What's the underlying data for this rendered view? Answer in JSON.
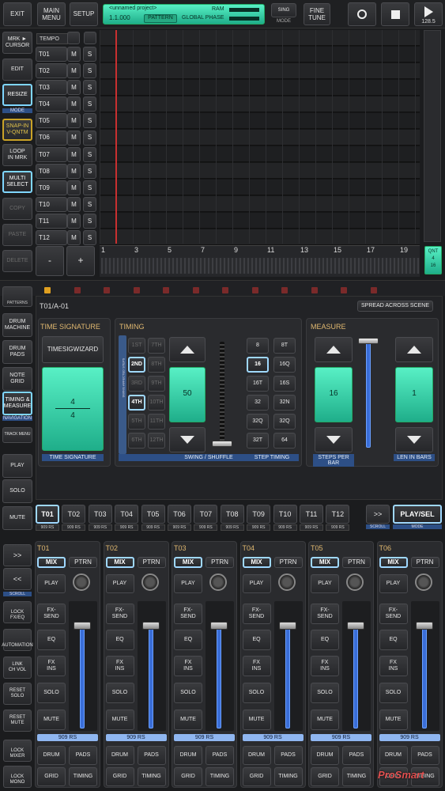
{
  "toolbar": {
    "exit": "EXIT",
    "main_menu": "MAIN MENU",
    "setup": "SETUP",
    "project_name": "<unnamed project>",
    "position": "1.1.000",
    "pattern_button": "PATTERN",
    "ram_label": "RAM",
    "global_phase_label": "GLOBAL PHASE",
    "sing_label": "SING",
    "mode_label": "MODE",
    "fine_tune": "FINE\nTUNE",
    "bpm": "128.5"
  },
  "left_tools": [
    {
      "label": "MRK ►\nCURSOR",
      "state": "normal"
    },
    {
      "label": "EDIT",
      "state": "normal"
    },
    {
      "label": "RESIZE",
      "state": "hl"
    },
    {
      "label": "SNAP-IN\nV-QNTM",
      "state": "yel"
    },
    {
      "label": "LOOP\nIN MRK",
      "state": "normal"
    },
    {
      "label": "MULTI\nSELECT",
      "state": "hl"
    },
    {
      "label": "COPY",
      "state": "dim"
    },
    {
      "label": "PASTE",
      "state": "dim"
    },
    {
      "label": "DELETE",
      "state": "dim"
    }
  ],
  "mode_label": "MODE",
  "tracks_header": "TEMPO",
  "tracks": [
    "T01",
    "T02",
    "T03",
    "T04",
    "T05",
    "T06",
    "T07",
    "T08",
    "T09",
    "T10",
    "T11",
    "T12"
  ],
  "mute_label": "M",
  "solo_label": "S",
  "zoom_minus": "-",
  "zoom_plus": "+",
  "ruler": [
    "1",
    "3",
    "5",
    "7",
    "9",
    "11",
    "13",
    "15",
    "17",
    "19"
  ],
  "qnt": {
    "label": "QNT",
    "value1": "4",
    "value2": "16"
  },
  "nav_buttons": [
    {
      "label": "DRUM\nMACHINE"
    },
    {
      "label": "DRUM\nPADS"
    },
    {
      "label": "NOTE\nGRID"
    },
    {
      "label": "TIMING &\nMEASURE"
    },
    {
      "label": "TRACK MENU"
    },
    {
      "label": "PLAY"
    },
    {
      "label": "SOLO"
    },
    {
      "label": "MUTE"
    }
  ],
  "patterns_label": "PATTERNS",
  "navigation_label": "NAVIGATION",
  "editor": {
    "title": "T01/A-01",
    "spread_button": "SPREAD ACROSS SCENE",
    "time_signature": {
      "section": "TIME SIGNATURE",
      "wizard": "TIMESIGWIZARD",
      "numerator": "4",
      "denominator": "4",
      "caption": "TIME SIGNATURE"
    },
    "timing": {
      "section": "TIMING",
      "steps": [
        [
          "1ST",
          "7TH"
        ],
        [
          "2ND",
          "8TH"
        ],
        [
          "3RD",
          "9TH"
        ],
        [
          "4TH",
          "10TH"
        ],
        [
          "5TH",
          "11TH"
        ],
        [
          "6TH",
          "12TH"
        ]
      ],
      "side_label": "SWING AFFECTED STEPS",
      "swing_value": "50",
      "swing_caption": "SWING / SHUFFLE",
      "step_timing": [
        [
          "8",
          "8T"
        ],
        [
          "16",
          "16Q"
        ],
        [
          "16T",
          "16S"
        ],
        [
          "32",
          "32N"
        ],
        [
          "32Q",
          "32Q"
        ],
        [
          "32T",
          "64"
        ]
      ],
      "step_caption": "STEP TIMING"
    },
    "measure": {
      "section": "MEASURE",
      "steps_per_bar": "16",
      "steps_caption": "STEPS PER BAR",
      "len_in_bars": "1",
      "len_caption": "LEN IN BARS"
    }
  },
  "track_tabs": [
    "T01",
    "T02",
    "T03",
    "T04",
    "T05",
    "T06",
    "T07",
    "T08",
    "T09",
    "T10",
    "T11",
    "T12"
  ],
  "track_tab_sub": "909 RS",
  "more_tab": ">>",
  "scroll_label": "SCROLL",
  "play_sel": "PLAY/SEL",
  "mode_sub": "MODE",
  "mixer_left": [
    {
      "label": ">>"
    },
    {
      "label": "<<"
    },
    {
      "label": "LOCK FX/EQ"
    },
    {
      "label": "AUTOMATION"
    },
    {
      "label": "LINK\nCH VOL"
    },
    {
      "label": "RESET\nSOLO"
    },
    {
      "label": "RESET\nMUTE"
    },
    {
      "label": "LOCK MIXER"
    },
    {
      "label": "LOCK MONO"
    }
  ],
  "channels": [
    {
      "name": "T01",
      "instrument": "909 RS"
    },
    {
      "name": "T02",
      "instrument": "909 RS"
    },
    {
      "name": "T03",
      "instrument": "909 RS"
    },
    {
      "name": "T04",
      "instrument": "909 RS"
    },
    {
      "name": "T05",
      "instrument": "909 RS"
    },
    {
      "name": "T06",
      "instrument": "909 RS"
    }
  ],
  "channel_buttons": {
    "mix": "MIX",
    "ptrn": "PTRN",
    "play": "PLAY",
    "fx_send": "FX-\nSEND",
    "eq": "EQ",
    "fx_ins": "FX\nINS",
    "solo": "SOLO",
    "mute": "MUTE",
    "drum": "DRUM",
    "pads": "PADS",
    "grid": "GRID",
    "timing": "TIMING"
  },
  "watermark": "ProSmart",
  "colors": {
    "accent_green": "#3fe0b0",
    "accent_blue": "#7fd6ff",
    "playhead_red": "#d03030",
    "title_orange": "#e0b870"
  }
}
